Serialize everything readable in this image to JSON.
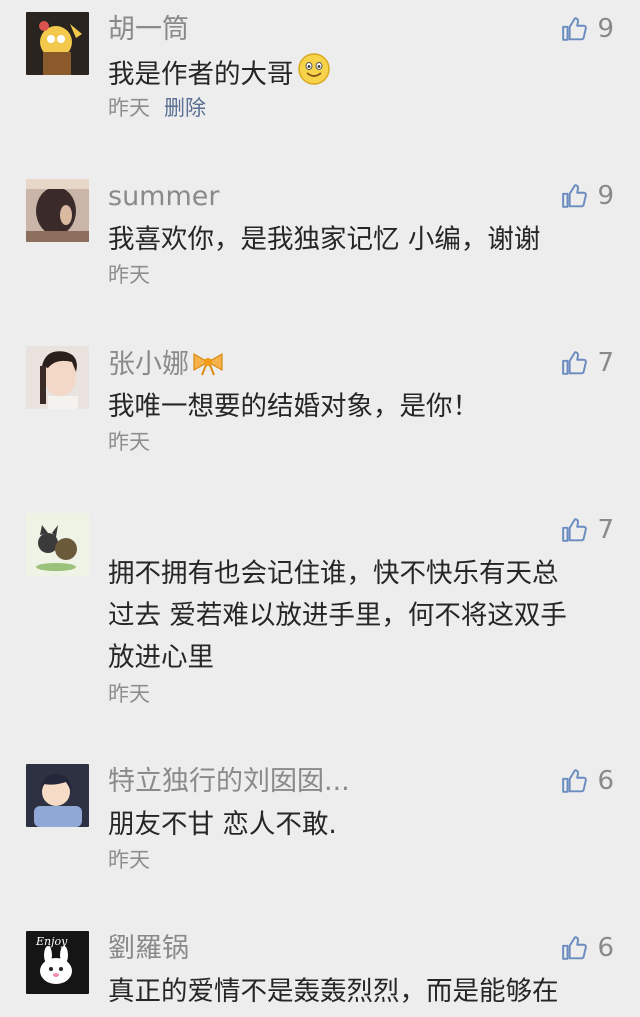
{
  "comments": [
    {
      "name": "胡一筒",
      "text": "我是作者的大哥",
      "likes": "9",
      "time": "昨天",
      "delete": "删除",
      "avatar": "cartoon-character-avatar"
    },
    {
      "name": "summer",
      "text": "我喜欢你，是我独家记忆 小编，谢谢",
      "likes": "9",
      "time": "昨天",
      "avatar": "girl-hair-avatar"
    },
    {
      "name": "张小娜",
      "text": "我唯一想要的结婚对象，是你！",
      "likes": "7",
      "time": "昨天",
      "avatar": "girl-photo-avatar"
    },
    {
      "name": "",
      "text_lines": [
        "拥不拥有也会记住谁，快不快乐有天总",
        "过去 爱若难以放进手里，何不将这双手",
        "放进心里"
      ],
      "likes": "7",
      "time": "昨天",
      "avatar": "anime-cats-avatar"
    },
    {
      "name": "特立独行的刘囡囡...",
      "text": "朋友不甘 恋人不敢.",
      "likes": "6",
      "time": "昨天",
      "avatar": "anime-boy-avatar"
    },
    {
      "name": "劉羅锅",
      "text": "真正的爱情不是轰轰烈烈，而是能够在",
      "likes": "6",
      "avatar": "enjoy-bunny-avatar"
    }
  ],
  "icons": {
    "like": "thumbs-up-icon",
    "smile": "smile-emoji-icon",
    "bow": "bow-emoji-icon"
  },
  "colors": {
    "background": "#ededed",
    "name": "#8a8a8a",
    "text": "#262626",
    "delete": "#5a6f94"
  }
}
